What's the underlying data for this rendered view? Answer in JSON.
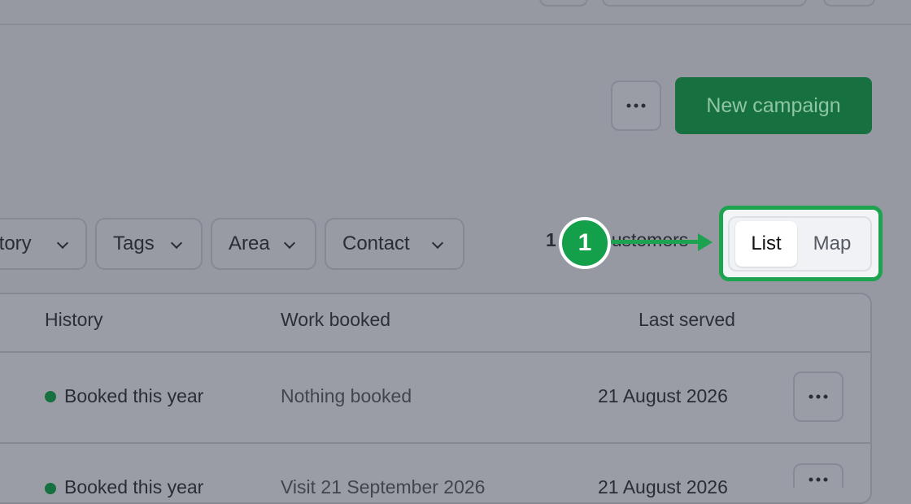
{
  "header": {
    "more_label": "More options",
    "new_campaign_label": "New campaign"
  },
  "filters": [
    {
      "label": "History"
    },
    {
      "label": "Tags"
    },
    {
      "label": "Area"
    },
    {
      "label": "Contact"
    }
  ],
  "results": {
    "count_prefix": "1",
    "count_suffix": "customers"
  },
  "annotation": {
    "step_number": "1"
  },
  "view_toggle": {
    "options": [
      "List",
      "Map"
    ],
    "selected": "List"
  },
  "table": {
    "columns": [
      "History",
      "Work booked",
      "Last served"
    ],
    "rows": [
      {
        "history": "Booked this year",
        "work_booked": "Nothing booked",
        "last_served": "21 August 2026"
      },
      {
        "history": "Booked this year",
        "work_booked": "Visit 21 September 2026",
        "last_served": "21 August 2026"
      }
    ]
  },
  "colors": {
    "primary": "#17703f",
    "highlight": "#1da24f",
    "status_dot": "#17703f"
  }
}
